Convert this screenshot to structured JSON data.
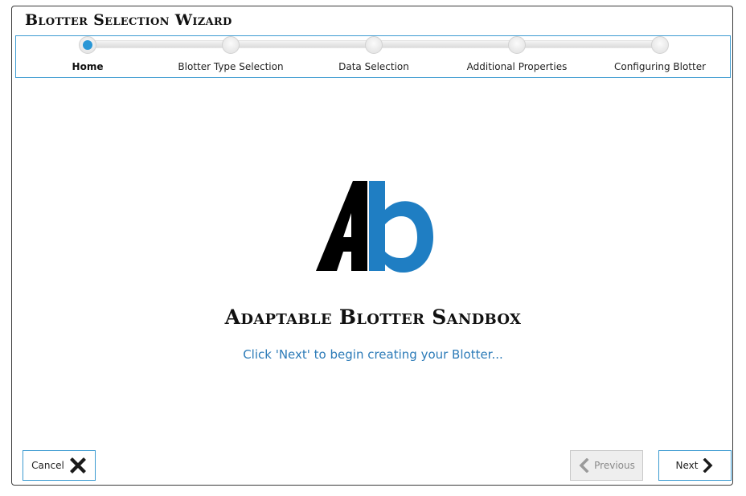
{
  "window": {
    "title": "Blotter Selection Wizard"
  },
  "stepper": {
    "steps": [
      {
        "label": "Home",
        "active": true
      },
      {
        "label": "Blotter Type Selection",
        "active": false
      },
      {
        "label": "Data Selection",
        "active": false
      },
      {
        "label": "Additional Properties",
        "active": false
      },
      {
        "label": "Configuring Blotter",
        "active": false
      }
    ]
  },
  "main": {
    "logo_text": "Ab",
    "title": "Adaptable Blotter Sandbox",
    "subtitle": "Click 'Next' to begin creating your Blotter..."
  },
  "footer": {
    "cancel_label": "Cancel",
    "previous_label": "Previous",
    "next_label": "Next",
    "previous_enabled": false
  },
  "colors": {
    "accent": "#2a97d6",
    "border_accent": "#3d9bd1",
    "subtitle": "#2c7bb8",
    "logo_blue": "#1f7ec3",
    "logo_black": "#000000"
  },
  "icons": {
    "cancel": "close-x-icon",
    "previous": "chevron-left-icon",
    "next": "chevron-right-icon"
  }
}
